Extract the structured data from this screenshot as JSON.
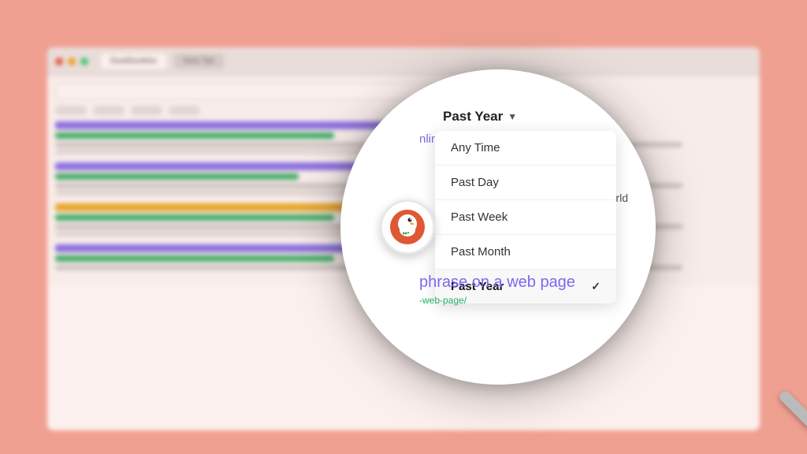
{
  "background": {
    "color": "#f0a090"
  },
  "browser": {
    "dots": [
      "red",
      "yellow",
      "green"
    ],
    "tabs": [
      {
        "label": "DuckDuckGo",
        "active": true
      },
      {
        "label": "New Tab",
        "active": false
      }
    ]
  },
  "magnifier": {
    "logo_emoji": "🦆",
    "background_text_world": "World",
    "background_link_text": "nline - w",
    "background_phrase_title": "phrase on a web page",
    "background_phrase_url": "-web-page/"
  },
  "dropdown": {
    "trigger_label": "Past Year",
    "trigger_icon": "▼",
    "items": [
      {
        "label": "Any Time",
        "selected": false
      },
      {
        "label": "Past Day",
        "selected": false
      },
      {
        "label": "Past Week",
        "selected": false
      },
      {
        "label": "Past Month",
        "selected": false
      },
      {
        "label": "Past Year",
        "selected": true
      }
    ],
    "checkmark": "✓"
  }
}
